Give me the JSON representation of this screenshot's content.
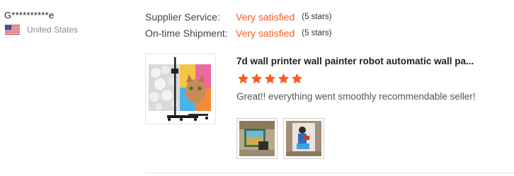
{
  "reviewer": {
    "name": "G**********e",
    "country": "United States",
    "flag_icon": "us-flag-icon"
  },
  "ratings": [
    {
      "label": "Supplier Service:",
      "value": "Very satisfied",
      "stars_text": "(5 stars)"
    },
    {
      "label": "On-time Shipment:",
      "value": "Very satisfied",
      "stars_text": "(5 stars)"
    }
  ],
  "review": {
    "product_title": "7d wall printer wall painter robot automatic wall pa...",
    "rating": 5,
    "text": "Great!! everything went smoothly recommendable seller!"
  },
  "colors": {
    "accent": "#ff5a1f",
    "star": "#ff5a1f"
  }
}
